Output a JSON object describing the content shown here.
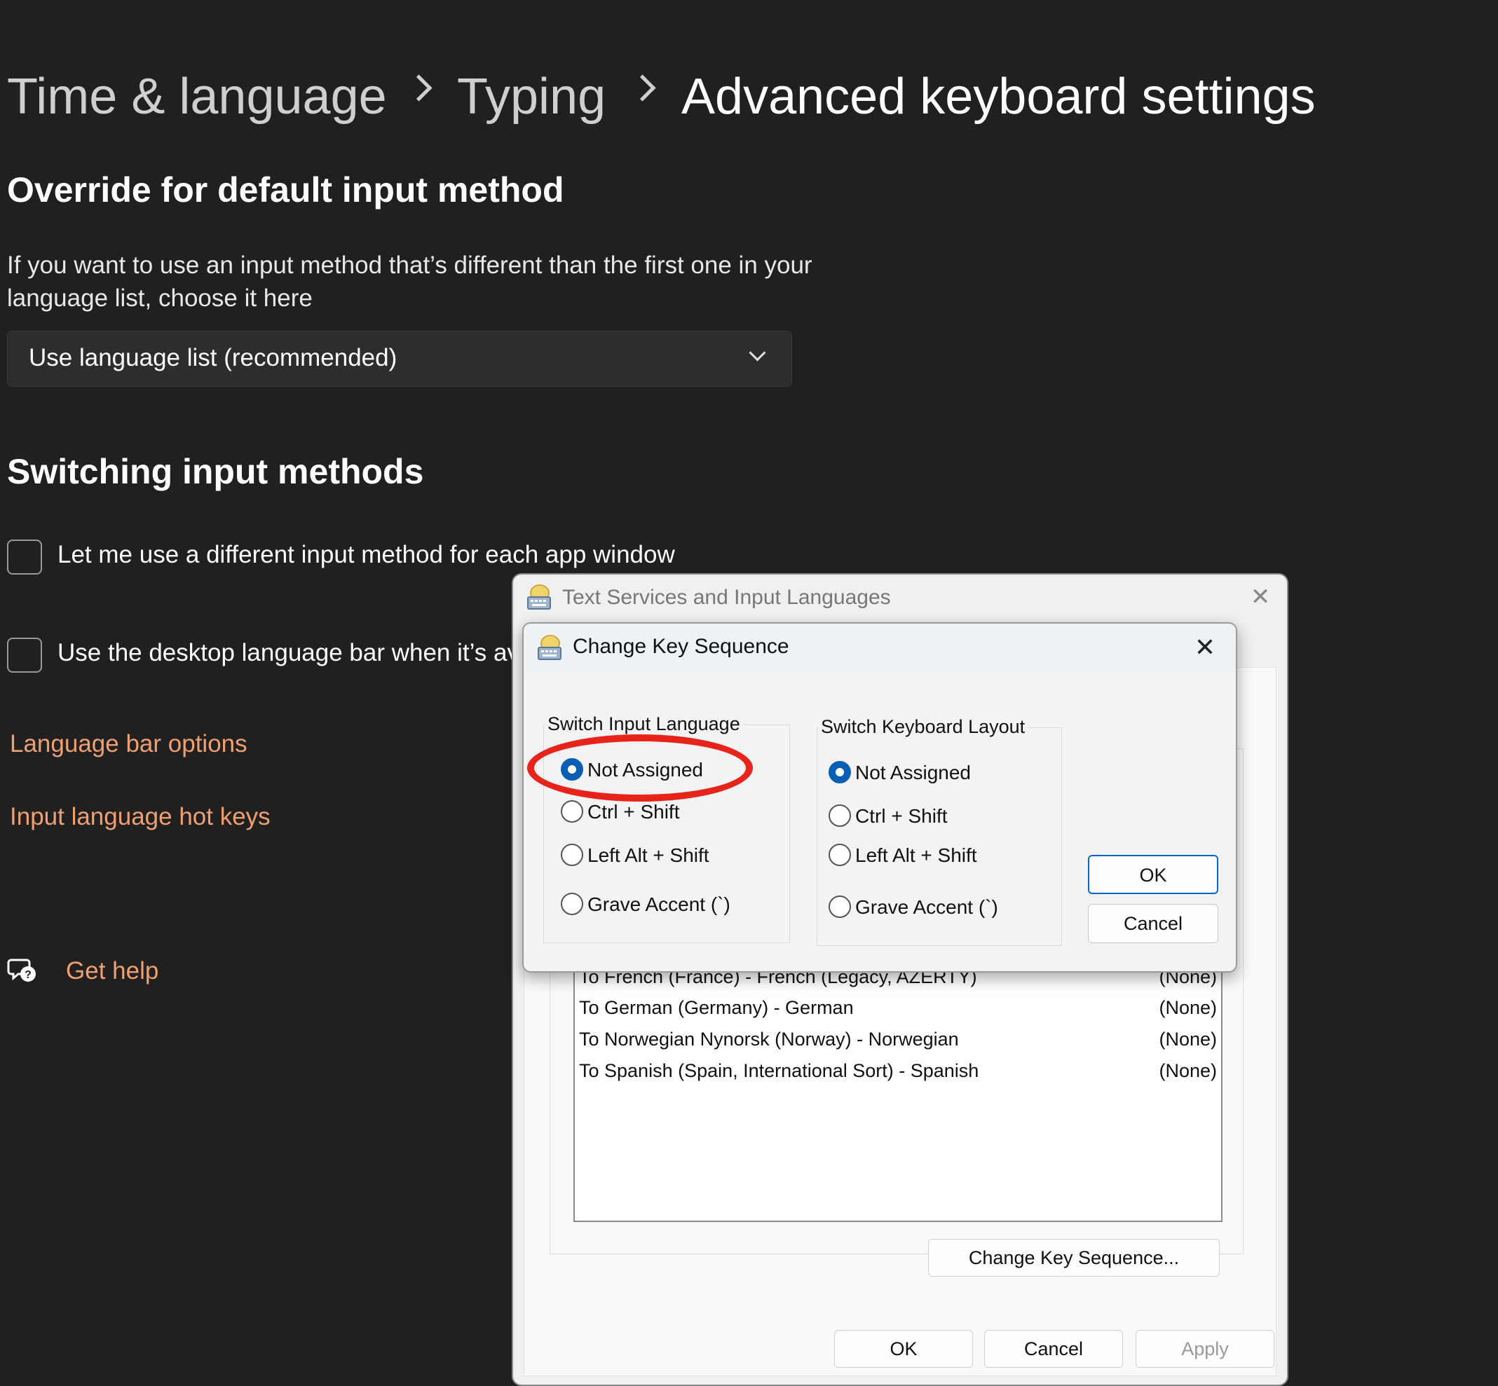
{
  "breadcrumb": {
    "items": [
      "Time & language",
      "Typing"
    ],
    "current": "Advanced keyboard settings"
  },
  "override_section": {
    "title": "Override for default input method",
    "description": "If you want to use an input method that’s different than the first one in your language list, choose it here",
    "dropdown_value": "Use language list (recommended)"
  },
  "switching_section": {
    "title": "Switching input methods",
    "checkbox1_label": "Let me use a different input method for each app window",
    "checkbox1_checked": false,
    "checkbox2_label": "Use the desktop language bar when it’s av",
    "checkbox2_checked": false
  },
  "links": {
    "language_bar_options": "Language bar options",
    "input_language_hot_keys": "Input language hot keys"
  },
  "help": {
    "label": "Get help",
    "icon": "help-chat-icon"
  },
  "text_services_dialog": {
    "title": "Text Services and Input Languages",
    "list_rows": [
      {
        "name": "To French (France) - French (Legacy, AZERTY)",
        "key": "(None)"
      },
      {
        "name": "To German (Germany) - German",
        "key": "(None)"
      },
      {
        "name": "To Norwegian Nynorsk (Norway) - Norwegian",
        "key": "(None)"
      },
      {
        "name": "To Spanish (Spain, International Sort) - Spanish",
        "key": "(None)"
      }
    ],
    "change_key_sequence_button": "Change Key Sequence...",
    "ok_button": "OK",
    "cancel_button": "Cancel",
    "apply_button": "Apply"
  },
  "change_key_dialog": {
    "title": "Change Key Sequence",
    "switch_input_language": {
      "legend": "Switch Input Language",
      "options": [
        "Not Assigned",
        "Ctrl + Shift",
        "Left Alt + Shift",
        "Grave Accent (`)"
      ],
      "selected": "Not Assigned"
    },
    "switch_keyboard_layout": {
      "legend": "Switch Keyboard Layout",
      "options": [
        "Not Assigned",
        "Ctrl + Shift",
        "Left Alt + Shift",
        "Grave Accent (`)"
      ],
      "selected": "Not Assigned"
    },
    "ok_button": "OK",
    "cancel_button": "Cancel"
  },
  "colors": {
    "background": "#202020",
    "link": "#f0a070",
    "accent": "#0a5fb4",
    "highlight": "#e8231a"
  }
}
